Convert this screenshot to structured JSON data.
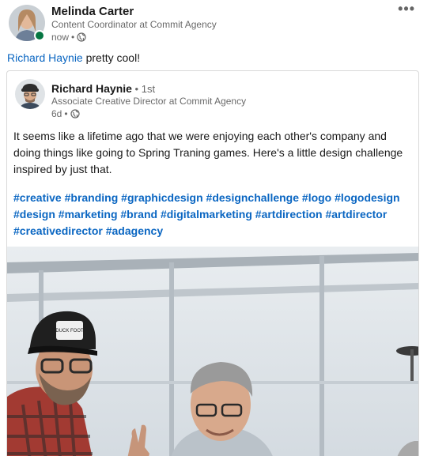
{
  "post": {
    "author": {
      "name": "Melinda Carter",
      "headline": "Content Coordinator at Commit Agency",
      "time": "now",
      "separator": "•",
      "visibility_icon": "globe-icon",
      "online": true
    },
    "more_icon": "more-horizontal-icon",
    "more_label": "•••",
    "commentary": {
      "mention": "Richard Haynie",
      "text": " pretty cool!"
    }
  },
  "shared": {
    "author": {
      "name": "Richard Haynie",
      "degree": " • 1st",
      "headline": "Associate Creative Director at Commit Agency",
      "time": "6d",
      "separator": "•",
      "visibility_icon": "globe-icon"
    },
    "text": "It seems like a lifetime ago that we were enjoying each other's company and doing things like going to Spring Traning games. Here's a little design challenge inspired by just that.",
    "hashtags": [
      "#creative",
      "#branding",
      "#graphicdesign",
      "#designchallenge",
      "#logo",
      "#logodesign",
      "#design",
      "#marketing",
      "#brand",
      "#digitalmarketing",
      "#artdirection",
      "#artdirector",
      "#creativedirector",
      "#adagency"
    ],
    "media": {
      "hat_text": "DUCK FOOT"
    }
  },
  "colors": {
    "link": "#0a66c2",
    "presence": "#057642",
    "border": "#d9d9d9"
  }
}
